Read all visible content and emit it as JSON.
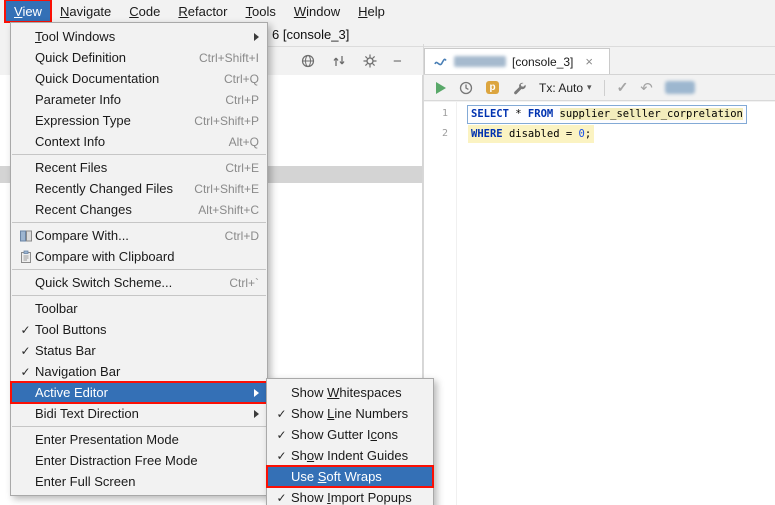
{
  "colors": {
    "selection_blue": "#3470b6",
    "annotation_red": "#fb1005",
    "menu_background": "#f2f2f2",
    "keyword_blue": "#0032b0",
    "number_blue": "#1750eb",
    "statement_highlight_yellow": "#fbf3c2",
    "table_highlight_yellow": "#f3edbc",
    "run_green": "#59a869"
  },
  "icons": {
    "check": "✓",
    "close": "×",
    "minus": "−",
    "dropdown_arrow": "▾",
    "commit_check": "✓",
    "rollback_arrow": "↶",
    "parameters_letter": "p"
  },
  "menu_bar": {
    "items": [
      {
        "label": "View",
        "active": true
      },
      {
        "label": "Navigate"
      },
      {
        "label": "Code"
      },
      {
        "label": "Refactor"
      },
      {
        "label": "Tools"
      },
      {
        "label": "Window"
      },
      {
        "label": "Help"
      }
    ]
  },
  "window": {
    "title_fragment": "6 [console_3]"
  },
  "editor_tab": {
    "suffix_label": "[console_3]"
  },
  "console_toolbar": {
    "tx_label": "Tx: Auto"
  },
  "editor": {
    "line_numbers": [
      "1",
      "2"
    ],
    "code": {
      "line1": {
        "select_kw": "SELECT",
        "star": "*",
        "from_kw": "FROM",
        "table": "supplier_selller_corprelation"
      },
      "line2": {
        "where_kw": "WHERE",
        "column": "disabled",
        "eq": "=",
        "value": "0",
        "semi": ";"
      }
    }
  },
  "view_menu": {
    "items": [
      {
        "label": "Tool Windows",
        "submenu": true
      },
      {
        "label": "Quick Definition",
        "shortcut": "Ctrl+Shift+I"
      },
      {
        "label": "Quick Documentation",
        "shortcut": "Ctrl+Q"
      },
      {
        "label": "Parameter Info",
        "shortcut": "Ctrl+P"
      },
      {
        "label": "Expression Type",
        "shortcut": "Ctrl+Shift+P"
      },
      {
        "label": "Context Info",
        "shortcut": "Alt+Q"
      },
      {
        "label": "Recent Files",
        "shortcut": "Ctrl+E"
      },
      {
        "label": "Recently Changed Files",
        "shortcut": "Ctrl+Shift+E"
      },
      {
        "label": "Recent Changes",
        "shortcut": "Alt+Shift+C"
      },
      {
        "label": "Compare With...",
        "shortcut": "Ctrl+D",
        "icon": "diff-icon"
      },
      {
        "label": "Compare with Clipboard",
        "icon": "clipboard-diff-icon"
      },
      {
        "label": "Quick Switch Scheme...",
        "shortcut": "Ctrl+`"
      },
      {
        "label": "Toolbar"
      },
      {
        "label": "Tool Buttons",
        "checked": true
      },
      {
        "label": "Status Bar",
        "checked": true
      },
      {
        "label": "Navigation Bar",
        "checked": true
      },
      {
        "label": "Active Editor",
        "selected": true,
        "submenu": true,
        "annotated": true
      },
      {
        "label": "Bidi Text Direction",
        "submenu": true
      },
      {
        "label": "Enter Presentation Mode"
      },
      {
        "label": "Enter Distraction Free Mode"
      },
      {
        "label": "Enter Full Screen"
      }
    ]
  },
  "active_editor_submenu": {
    "items": [
      {
        "label": "Show Whitespaces"
      },
      {
        "label": "Show Line Numbers",
        "checked": true
      },
      {
        "label": "Show Gutter Icons",
        "checked": true
      },
      {
        "label": "Show Indent Guides",
        "checked": true
      },
      {
        "label": "Use Soft Wraps",
        "selected": true,
        "annotated": true
      },
      {
        "label": "Show Import Popups",
        "checked": true
      }
    ]
  }
}
